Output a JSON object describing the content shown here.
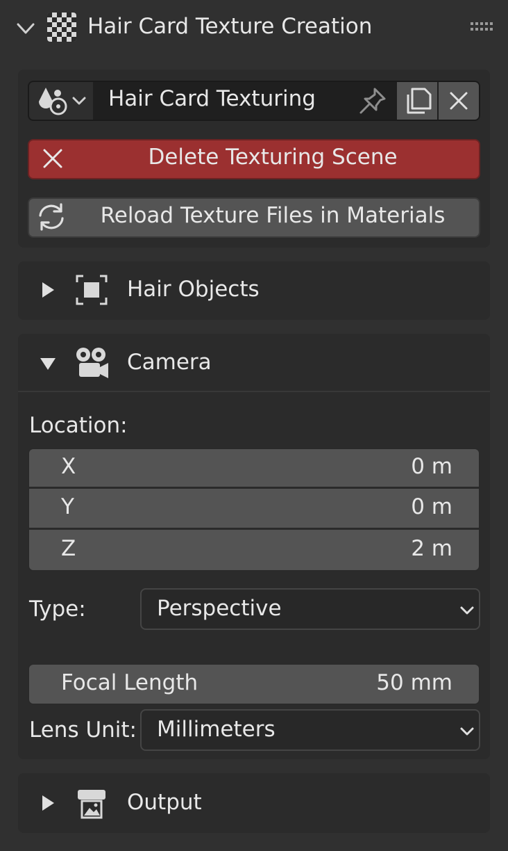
{
  "header": {
    "title": "Hair Card Texture Creation",
    "expand_icon": "chevron-down-icon",
    "panel_icon": "checker-texture-icon",
    "drag_icon": "drag-handle-icon"
  },
  "scene_selector": {
    "name": "Hair Card Texturing",
    "type_icon": "scene-data-icon",
    "pin_icon": "pin-icon",
    "copy_icon": "duplicate-icon",
    "close_icon": "close-icon"
  },
  "buttons": {
    "delete_label": "Delete Texturing Scene",
    "reload_label": "Reload Texture Files in Materials"
  },
  "subpanels": {
    "hair_objects": {
      "title": "Hair Objects",
      "expanded": false,
      "icon": "object-bounds-icon"
    },
    "camera": {
      "title": "Camera",
      "expanded": true,
      "icon": "camera-icon"
    },
    "output": {
      "title": "Output",
      "expanded": false,
      "icon": "output-printer-icon"
    }
  },
  "camera": {
    "location_label": "Location:",
    "location": [
      {
        "axis": "X",
        "value": "0 m"
      },
      {
        "axis": "Y",
        "value": "0 m"
      },
      {
        "axis": "Z",
        "value": "2 m"
      }
    ],
    "type_label": "Type:",
    "type_value": "Perspective",
    "focal_length_label": "Focal Length",
    "focal_length_value": "50 mm",
    "lens_unit_label": "Lens Unit:",
    "lens_unit_value": "Millimeters"
  },
  "colors": {
    "background": "#303030",
    "panel": "#3d3d3d",
    "delete_button": "#9b3030",
    "field": "#545454",
    "dropdown": "#282828",
    "text": "#e8e8e8"
  }
}
